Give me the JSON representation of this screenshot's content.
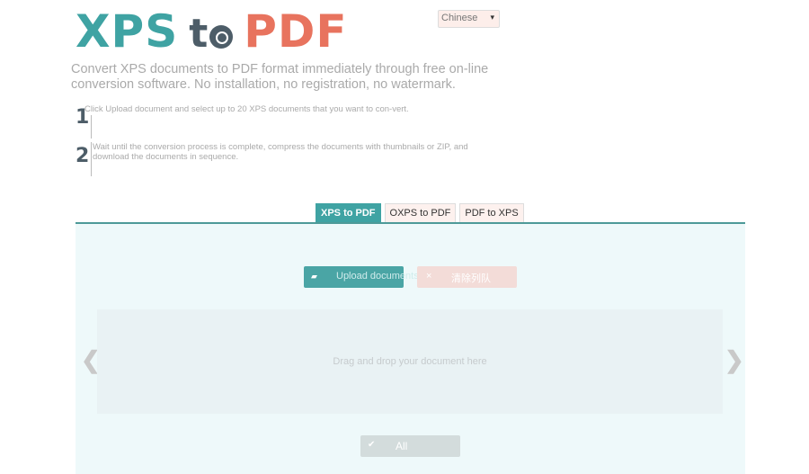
{
  "logo": {
    "part1": "XPS",
    "part2": "t",
    "part3": "PDF"
  },
  "language_select": {
    "value": "Chinese",
    "chevron": "▾"
  },
  "intro": "Convert XPS documents to PDF format immediately through free on-line conversion software. No installation, no registration, no watermark.",
  "steps": [
    {
      "number": "1",
      "text": "Click Upload document and select up to 20 XPS documents that you want to con-vert."
    },
    {
      "number": "2",
      "text": "Wait until the conversion process is complete, compress the documents with thumbnails or ZIP, and download the documents in sequence."
    }
  ],
  "tabs": [
    {
      "label": "XPS to PDF",
      "active": true
    },
    {
      "label": "OXPS to PDF",
      "active": false
    },
    {
      "label": "PDF to XPS",
      "active": false
    }
  ],
  "buttons": {
    "upload_icon": "folder-open-icon",
    "upload": "Upload documents",
    "clear_icon": "×",
    "clear": "清除列队",
    "all_icon": "✔",
    "all": "All"
  },
  "dropzone": {
    "text": "Drag and drop your document here"
  },
  "nav": {
    "prev": "❮",
    "next": "❯"
  },
  "colors": {
    "teal": "#3fa3a3",
    "slate": "#4d5d68",
    "salmon": "#e8735e"
  }
}
